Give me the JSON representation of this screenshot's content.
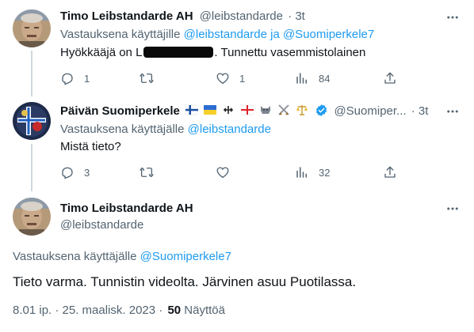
{
  "colors": {
    "accent": "#1d9bf0",
    "muted": "#536471",
    "text": "#0f1419",
    "border": "#eff3f4"
  },
  "tweets": [
    {
      "author": "Timo Leibstandarde AH",
      "handle": "@leibstandarde",
      "time": "· 3t",
      "reply_prefix": "Vastauksena käyttäjille",
      "reply_to": "@leibstandarde ja @Suomiperkele7",
      "text_before": "Hyökkääjä on ",
      "text_redacted": "L",
      "text_after": ". Tunnettu vasemmistolainen",
      "replies": "1",
      "retweets": "",
      "likes": "1",
      "views": "84"
    },
    {
      "author": "Päivän Suomiperkele",
      "name_emojis": [
        "finland-flag-emoji",
        "ukraine-flag-emoji",
        "cross-emoji",
        "georgia-flag-emoji",
        "wolf-emoji",
        "crossed-swords-emoji",
        "scales-emoji"
      ],
      "handle": "@Suomiper...",
      "time": "· 3t",
      "reply_prefix": "Vastauksena käyttäjälle",
      "reply_to": "@leibstandarde",
      "text": "Mistä tieto?",
      "replies": "3",
      "retweets": "",
      "likes": "",
      "views": "32"
    }
  ],
  "main_tweet": {
    "author": "Timo Leibstandarde AH",
    "handle": "@leibstandarde",
    "reply_prefix": "Vastauksena käyttäjälle",
    "reply_to": "@Suomiperkele7",
    "text": "Tieto varma. Tunnistin videolta. Järvinen asuu Puotilassa.",
    "timestamp": "8.01 ip. · 25. maalisk. 2023 ·",
    "views_count": "50",
    "views_label": "Näyttöä"
  },
  "icons": {
    "more": "more-horizontal-icon",
    "reply": "reply-icon",
    "retweet": "retweet-icon",
    "like": "heart-icon",
    "views": "views-icon",
    "share": "share-icon",
    "verified": "verified-badge-icon"
  }
}
